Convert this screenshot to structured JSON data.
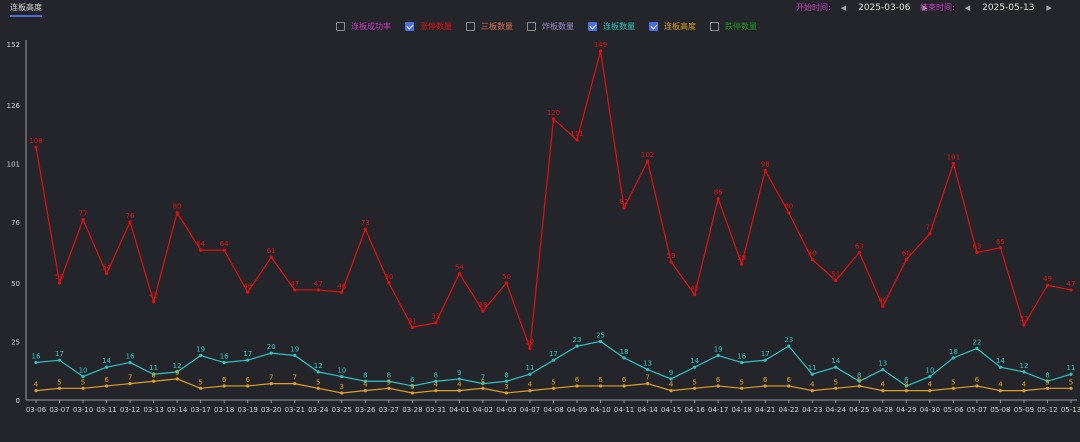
{
  "tab": {
    "label": "连板高度"
  },
  "date_range": {
    "start_label": "开始时间:",
    "start_value": "2025-03-06",
    "end_label": "结束时间:",
    "end_value": "2025-05-13",
    "prev_icon": "caret-left-icon",
    "next_icon": "caret-right-icon"
  },
  "legend": [
    {
      "label": "连板成功率",
      "checked": false,
      "color": "#c238c2"
    },
    {
      "label": "涨停数量",
      "checked": true,
      "color": "#e01010"
    },
    {
      "label": "三板数量",
      "checked": false,
      "color": "#e06a4a"
    },
    {
      "label": "炸板数量",
      "checked": false,
      "color": "#9a8ac8"
    },
    {
      "label": "连板数量",
      "checked": true,
      "color": "#2ec4c4"
    },
    {
      "label": "连板高度",
      "checked": true,
      "color": "#e0a020"
    },
    {
      "label": "跌停数量",
      "checked": false,
      "color": "#1a9a1a"
    }
  ],
  "chart_data": {
    "type": "line",
    "categories": [
      "03-06",
      "03-07",
      "03-10",
      "03-11",
      "03-12",
      "03-13",
      "03-14",
      "03-17",
      "03-18",
      "03-19",
      "03-20",
      "03-21",
      "03-24",
      "03-25",
      "03-26",
      "03-27",
      "03-28",
      "03-31",
      "04-01",
      "04-02",
      "04-03",
      "04-07",
      "04-08",
      "04-09",
      "04-10",
      "04-11",
      "04-14",
      "04-15",
      "04-16",
      "04-17",
      "04-18",
      "04-21",
      "04-22",
      "04-23",
      "04-24",
      "04-25",
      "04-28",
      "04-29",
      "04-30",
      "05-06",
      "05-07",
      "05-08",
      "05-09",
      "05-12",
      "05-13"
    ],
    "y_ticks": [
      "0",
      "25",
      "50",
      "76",
      "101",
      "126",
      "152"
    ],
    "ylim": [
      0,
      152
    ],
    "series": [
      {
        "name": "涨停数量",
        "color": "#e01010",
        "values": [
          108,
          50,
          77,
          54,
          76,
          42,
          80,
          64,
          64,
          46,
          61,
          47,
          47,
          46,
          73,
          50,
          31,
          33,
          54,
          38,
          50,
          22,
          120,
          111,
          149,
          82,
          102,
          59,
          45,
          86,
          58,
          98,
          80,
          60,
          51,
          63,
          40,
          60,
          71,
          101,
          63,
          65,
          32,
          49,
          47
        ]
      },
      {
        "name": "连板数量",
        "color": "#2ec4c4",
        "values": [
          16,
          17,
          10,
          14,
          16,
          11,
          12,
          19,
          16,
          17,
          20,
          19,
          12,
          10,
          8,
          8,
          6,
          8,
          9,
          7,
          8,
          11,
          17,
          23,
          25,
          18,
          13,
          9,
          14,
          19,
          16,
          17,
          23,
          11,
          14,
          8,
          13,
          6,
          10,
          18,
          22,
          14,
          12,
          8,
          11
        ]
      },
      {
        "name": "连板高度",
        "color": "#e0a020",
        "values": [
          4,
          5,
          5,
          6,
          7,
          8,
          9,
          5,
          6,
          6,
          7,
          7,
          5,
          3,
          4,
          5,
          3,
          4,
          4,
          5,
          3,
          4,
          5,
          6,
          6,
          6,
          7,
          4,
          5,
          6,
          5,
          6,
          6,
          4,
          5,
          6,
          4,
          4,
          4,
          5,
          6,
          4,
          4,
          5,
          5
        ]
      }
    ]
  }
}
